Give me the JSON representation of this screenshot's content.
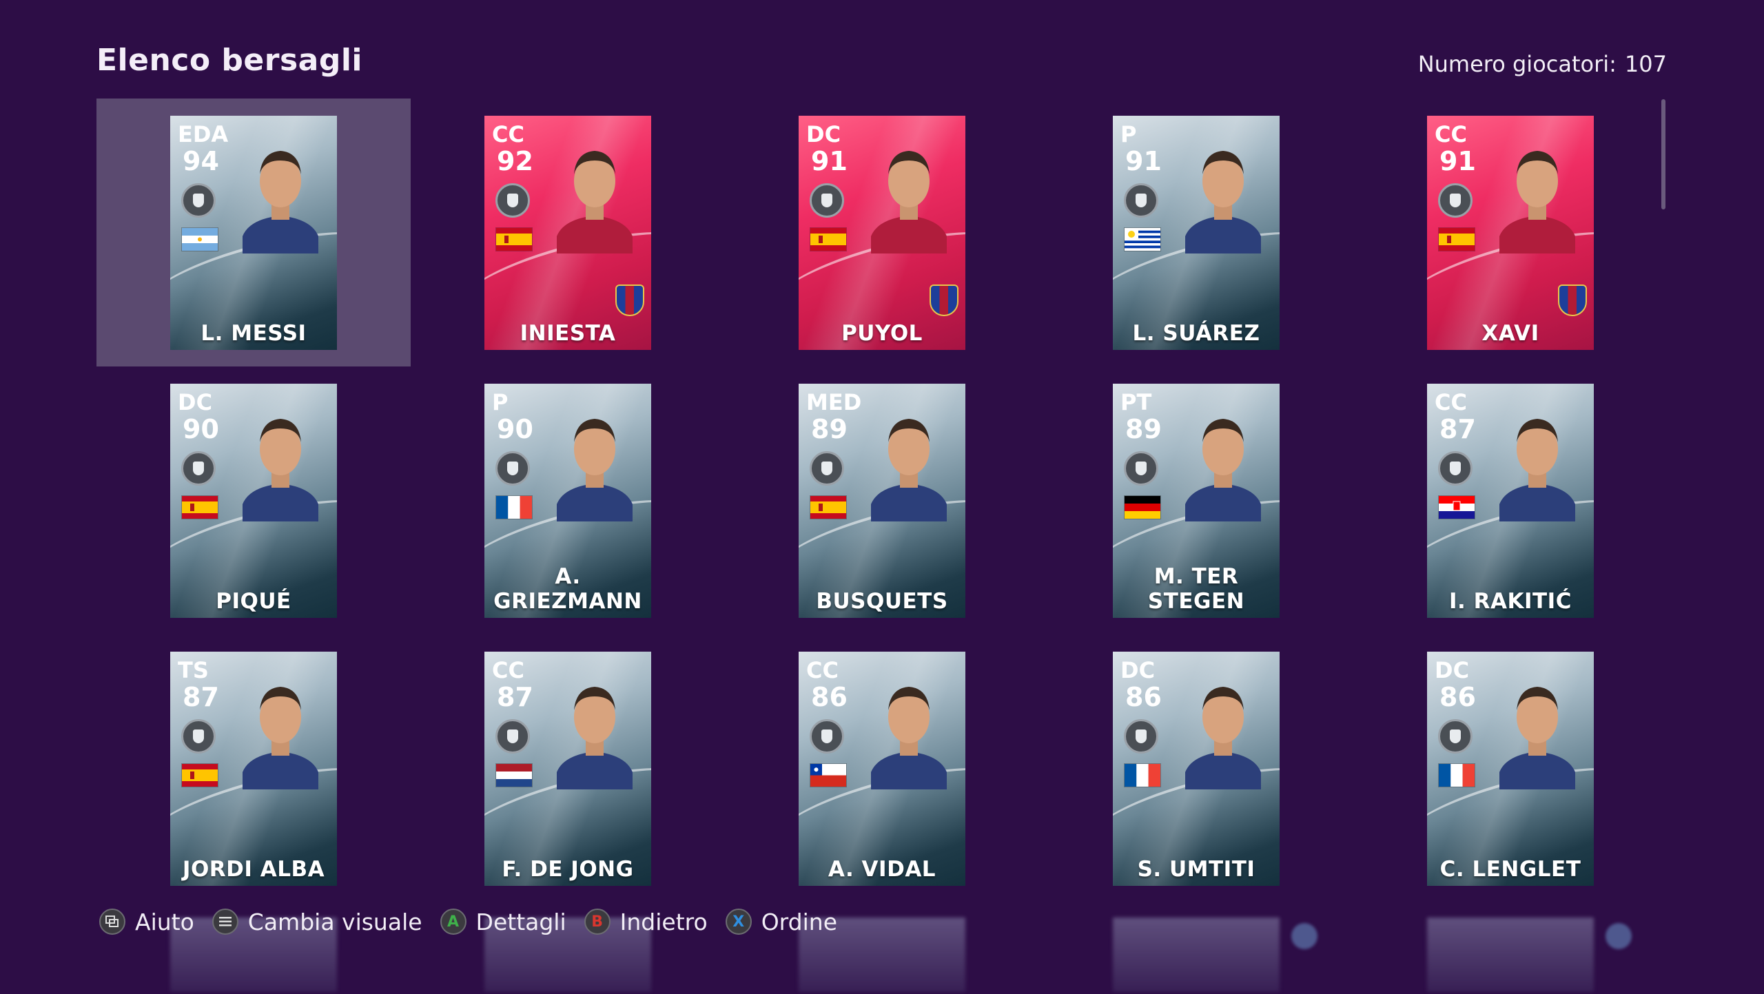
{
  "header": {
    "title": "Elenco bersagli",
    "count_label": "Numero giocatori:",
    "count_value": "107"
  },
  "colors": {
    "background": "#2d0d46",
    "card_pink": "#ef2d63",
    "card_blue": "#6b8796",
    "selected": "#5b4a70"
  },
  "cards": [
    {
      "pos": "EDA",
      "rating": "94",
      "name": "L. MESSI",
      "nation": "argentina",
      "style": "blue",
      "club_badge": false,
      "selected": true
    },
    {
      "pos": "CC",
      "rating": "92",
      "name": "INIESTA",
      "nation": "spain",
      "style": "pink",
      "club_badge": true,
      "selected": false
    },
    {
      "pos": "DC",
      "rating": "91",
      "name": "PUYOL",
      "nation": "spain",
      "style": "pink",
      "club_badge": true,
      "selected": false
    },
    {
      "pos": "P",
      "rating": "91",
      "name": "L. SUÁREZ",
      "nation": "uruguay",
      "style": "blue",
      "club_badge": false,
      "selected": false
    },
    {
      "pos": "CC",
      "rating": "91",
      "name": "XAVI",
      "nation": "spain",
      "style": "pink",
      "club_badge": true,
      "selected": false
    },
    {
      "pos": "DC",
      "rating": "90",
      "name": "PIQUÉ",
      "nation": "spain",
      "style": "blue",
      "club_badge": false,
      "selected": false
    },
    {
      "pos": "P",
      "rating": "90",
      "name": "A. GRIEZMANN",
      "nation": "france",
      "style": "blue",
      "club_badge": false,
      "selected": false
    },
    {
      "pos": "MED",
      "rating": "89",
      "name": "BUSQUETS",
      "nation": "spain",
      "style": "blue",
      "club_badge": false,
      "selected": false
    },
    {
      "pos": "PT",
      "rating": "89",
      "name": "M. TER STEGEN",
      "nation": "germany",
      "style": "blue",
      "club_badge": false,
      "selected": false
    },
    {
      "pos": "CC",
      "rating": "87",
      "name": "I. RAKITIĆ",
      "nation": "croatia",
      "style": "blue",
      "club_badge": false,
      "selected": false
    },
    {
      "pos": "TS",
      "rating": "87",
      "name": "JORDI ALBA",
      "nation": "spain",
      "style": "blue",
      "club_badge": false,
      "selected": false
    },
    {
      "pos": "CC",
      "rating": "87",
      "name": "F. DE JONG",
      "nation": "netherlands",
      "style": "blue",
      "club_badge": false,
      "selected": false
    },
    {
      "pos": "CC",
      "rating": "86",
      "name": "A. VIDAL",
      "nation": "chile",
      "style": "blue",
      "club_badge": false,
      "selected": false
    },
    {
      "pos": "DC",
      "rating": "86",
      "name": "S. UMTITI",
      "nation": "france",
      "style": "blue",
      "club_badge": false,
      "selected": false
    },
    {
      "pos": "DC",
      "rating": "86",
      "name": "C. LENGLET",
      "nation": "france",
      "style": "blue",
      "club_badge": false,
      "selected": false
    }
  ],
  "footer": {
    "help": {
      "icon": "view-button-icon",
      "label": "Aiuto"
    },
    "view": {
      "icon": "menu-button-icon",
      "label": "Cambia visuale"
    },
    "details": {
      "key": "A",
      "color": "#3fb04a",
      "label": "Dettagli"
    },
    "back": {
      "key": "B",
      "color": "#d8362f",
      "label": "Indietro"
    },
    "sort": {
      "key": "X",
      "color": "#2f8fe0",
      "label": "Ordine"
    }
  }
}
